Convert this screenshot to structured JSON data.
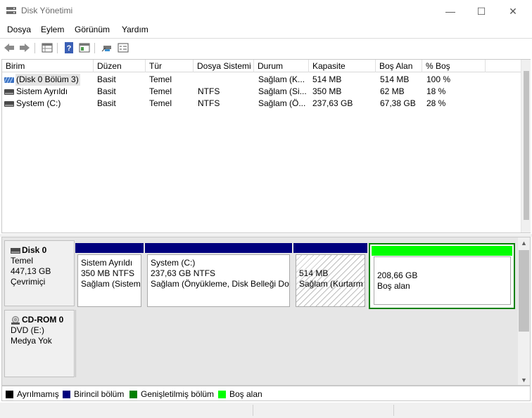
{
  "window": {
    "title": "Disk Yönetimi",
    "controls": {
      "minimize": "—",
      "maximize": "☐",
      "close": "✕"
    }
  },
  "menu": [
    "Dosya",
    "Eylem",
    "Görünüm",
    "Yardım"
  ],
  "toolbar": {
    "icons": [
      "back-arrow-icon",
      "forward-arrow-icon",
      "properties-grid-icon",
      "help-icon",
      "console-icon",
      "connect-icon",
      "settings-list-icon"
    ]
  },
  "volume_list": {
    "columns": [
      "Birim",
      "Düzen",
      "Tür",
      "Dosya Sistemi",
      "Durum",
      "Kapasite",
      "Boş Alan",
      "% Boş"
    ],
    "rows": [
      {
        "name": "(Disk 0 Bölüm 3)",
        "layout": "Basit",
        "type": "Temel",
        "fs": "",
        "status": "Sağlam (K...",
        "capacity": "514 MB",
        "free": "514 MB",
        "pct": "100 %",
        "icon": "striped-volume-icon",
        "selected": true
      },
      {
        "name": "Sistem Ayrıldı",
        "layout": "Basit",
        "type": "Temel",
        "fs": "NTFS",
        "status": "Sağlam (Si...",
        "capacity": "350 MB",
        "free": "62 MB",
        "pct": "18 %",
        "icon": "volume-icon",
        "selected": false
      },
      {
        "name": "System (C:)",
        "layout": "Basit",
        "type": "Temel",
        "fs": "NTFS",
        "status": "Sağlam (Ö...",
        "capacity": "237,63 GB",
        "free": "67,38 GB",
        "pct": "28 %",
        "icon": "volume-icon",
        "selected": false
      }
    ]
  },
  "disks": [
    {
      "label": {
        "name": "Disk 0",
        "type": "Temel",
        "size": "447,13 GB",
        "state": "Çevrimiçi"
      },
      "partitions": [
        {
          "title": "Sistem Ayrıldı",
          "line1": "350 MB NTFS",
          "line2": "Sağlam (Sistem,",
          "bar": "#00007e",
          "style": "normal"
        },
        {
          "title": "System  (C:)",
          "line1": "237,63 GB NTFS",
          "line2": "Sağlam (Önyükleme, Disk Belleği Dos",
          "bar": "#00007e",
          "style": "normal"
        },
        {
          "title": "",
          "line1": "514 MB",
          "line2": "Sağlam (Kurtarm",
          "bar": "#00007e",
          "style": "hatched"
        },
        {
          "title": "",
          "line1": "208,66 GB",
          "line2": "Boş alan",
          "bar": "#00ff00",
          "style": "selected-free"
        }
      ]
    },
    {
      "label": {
        "name": "CD-ROM 0",
        "type": "DVD (E:)",
        "size": "",
        "state": "Medya Yok"
      },
      "partitions": []
    }
  ],
  "legend": [
    {
      "label": "Ayrılmamış",
      "color": "#000000"
    },
    {
      "label": "Birincil bölüm",
      "color": "#00007e"
    },
    {
      "label": "Genişletilmiş bölüm",
      "color": "#008000"
    },
    {
      "label": "Boş alan",
      "color": "#00ff00"
    }
  ],
  "colors": {
    "primary_partition": "#00007e",
    "free_space": "#00ff00",
    "free_space_border": "#008000",
    "selection": "#cce8ff"
  }
}
